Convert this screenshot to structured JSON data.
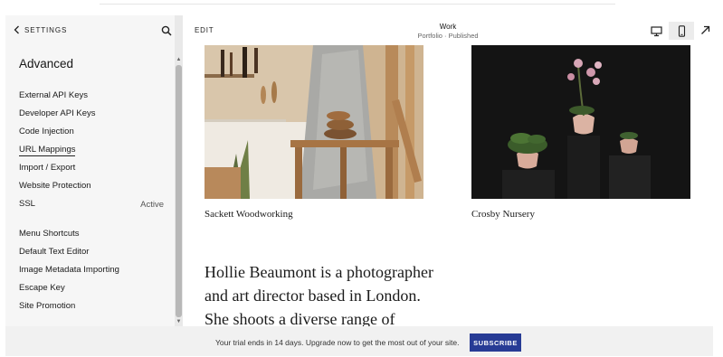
{
  "sidebar": {
    "back_label": "SETTINGS",
    "section_title": "Advanced",
    "items": [
      {
        "label": "External API Keys"
      },
      {
        "label": "Developer API Keys"
      },
      {
        "label": "Code Injection"
      },
      {
        "label": "URL Mappings",
        "selected": true
      },
      {
        "label": "Import / Export"
      },
      {
        "label": "Website Protection"
      },
      {
        "label": "SSL",
        "status": "Active"
      }
    ],
    "items_secondary": [
      {
        "label": "Menu Shortcuts"
      },
      {
        "label": "Default Text Editor"
      },
      {
        "label": "Image Metadata Importing"
      },
      {
        "label": "Escape Key"
      },
      {
        "label": "Site Promotion"
      }
    ]
  },
  "toolbar": {
    "edit_label": "EDIT",
    "page_title": "Work",
    "page_subtitle": "Portfolio · Published",
    "device_buttons": [
      "desktop-icon",
      "mobile-icon"
    ],
    "active_device": "mobile-icon",
    "expand_icon": "expand-arrow-icon"
  },
  "canvas": {
    "projects": [
      {
        "title": "Sackett Woodworking"
      },
      {
        "title": "Crosby Nursery"
      }
    ],
    "bio_lines": [
      "Hollie Beaumont is a photographer",
      "and art director based in London.",
      "She shoots a diverse range of"
    ]
  },
  "trial_banner": {
    "message": "Your trial ends in 14 days. Upgrade now to get the most out of your site.",
    "button_label": "SUBSCRIBE"
  },
  "colors": {
    "subscribe_button": "#273b95",
    "panel_background": "#f6f6f6"
  }
}
